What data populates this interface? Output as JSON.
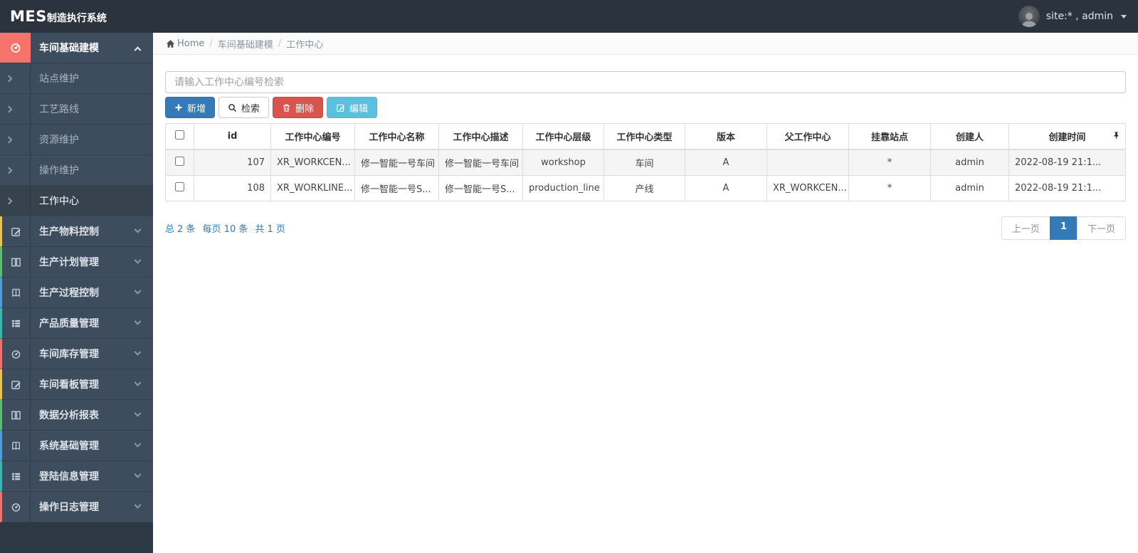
{
  "topbar": {
    "brand_bold": "MES",
    "brand_rest": "制造执行系统",
    "user_label": "site:* , admin"
  },
  "sidebar": {
    "active_parent": "车间基础建模",
    "submenu": [
      "站点维护",
      "工艺路线",
      "资源维护",
      "操作维护",
      "工作中心"
    ],
    "active_submenu": "工作中心",
    "parents": [
      "生产物料控制",
      "生产计划管理",
      "生产过程控制",
      "产品质量管理",
      "车间库存管理",
      "车间看板管理",
      "数据分析报表",
      "系统基础管理",
      "登陆信息管理",
      "操作日志管理"
    ]
  },
  "breadcrumb": {
    "home": "Home",
    "section": "车间基础建模",
    "current": "工作中心"
  },
  "toolbar": {
    "search_placeholder": "请输入工作中心编号检索",
    "add": "新增",
    "search": "检索",
    "delete": "删除",
    "edit": "编辑"
  },
  "table": {
    "columns": [
      "id",
      "工作中心编号",
      "工作中心名称",
      "工作中心描述",
      "工作中心层级",
      "工作中心类型",
      "版本",
      "父工作中心",
      "挂靠站点",
      "创建人",
      "创建时间"
    ],
    "rows": [
      [
        "107",
        "XR_WORKCEN...",
        "修一智能一号车间",
        "修一智能一号车间",
        "workshop",
        "车间",
        "A",
        "",
        "*",
        "admin",
        "2022-08-19 21:1..."
      ],
      [
        "108",
        "XR_WORKLINE...",
        "修一智能一号S...",
        "修一智能一号S...",
        "production_line",
        "产线",
        "A",
        "XR_WORKCEN...",
        "*",
        "admin",
        "2022-08-19 21:1..."
      ]
    ]
  },
  "footer": {
    "total": "总 2 条",
    "per_page": "每页 10 条",
    "pages": "共 1 页"
  },
  "pagination": {
    "prev": "上一页",
    "current": "1",
    "next": "下一页"
  },
  "colors": {
    "primary": "#337ab7",
    "danger": "#d9534f",
    "info": "#5bc0de",
    "link": "#337ab7",
    "topbar": "#2a333e",
    "sidebar": "#3e4d5d",
    "sidebar-dark": "#2d3845",
    "item-border": "#35414e",
    "submenu-active": "#36434f",
    "active-salmon": "#f4736b",
    "accent-yellow": "#e8c35c",
    "accent-green": "#5fb878",
    "accent-blue": "#539dd4",
    "accent-teal": "#3fb6ad",
    "accent-red": "#e8736f"
  }
}
